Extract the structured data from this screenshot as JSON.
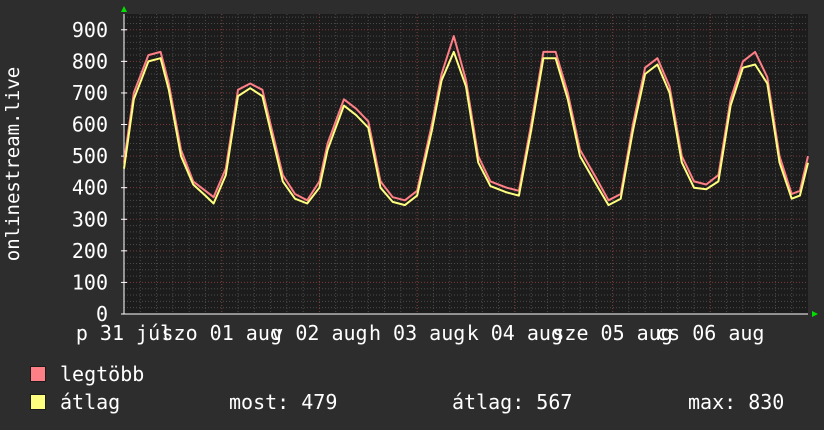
{
  "chart_data": {
    "type": "line",
    "ylabel": "onlinestream.live",
    "ylim": [
      0,
      950
    ],
    "yticks": [
      0,
      100,
      200,
      300,
      400,
      500,
      600,
      700,
      800,
      900
    ],
    "xlim": [
      0,
      8.4
    ],
    "x_ticks": [
      {
        "label": "p 31 júl",
        "x": 0
      },
      {
        "label": "szo 01 aug",
        "x": 1.2
      },
      {
        "label": "v 02 aug",
        "x": 2.4
      },
      {
        "label": "h 03 aug",
        "x": 3.6
      },
      {
        "label": "k 04 aug",
        "x": 4.8
      },
      {
        "label": "sze 05 aug",
        "x": 6.0
      },
      {
        "label": "cs 06 aug",
        "x": 7.2
      }
    ],
    "grid": true,
    "legend_position": "bottom-left",
    "colors": {
      "background": "#2d2d2d",
      "canvas": "#1c1c1c",
      "grid_minor": "#4a4a4a",
      "grid_major": "#7a3a3a",
      "axis": "#ffffff",
      "arrow": "#00e000",
      "text": "#ffffff"
    },
    "series": [
      {
        "name": "legtöbb",
        "color": "#ff7f86",
        "x": [
          0,
          0.12,
          0.3,
          0.45,
          0.55,
          0.7,
          0.85,
          1.0,
          1.1,
          1.25,
          1.4,
          1.55,
          1.7,
          1.8,
          1.95,
          2.1,
          2.25,
          2.4,
          2.5,
          2.7,
          2.85,
          3.0,
          3.15,
          3.3,
          3.45,
          3.6,
          3.78,
          3.9,
          4.05,
          4.2,
          4.35,
          4.5,
          4.7,
          4.85,
          5.0,
          5.15,
          5.3,
          5.45,
          5.6,
          5.8,
          5.95,
          6.1,
          6.25,
          6.4,
          6.55,
          6.7,
          6.85,
          7.0,
          7.15,
          7.3,
          7.45,
          7.6,
          7.75,
          7.9,
          8.05,
          8.2,
          8.3,
          8.4
        ],
        "values": [
          480,
          700,
          820,
          830,
          730,
          520,
          420,
          390,
          370,
          460,
          710,
          730,
          710,
          600,
          440,
          380,
          360,
          420,
          540,
          680,
          650,
          610,
          420,
          370,
          360,
          390,
          600,
          760,
          880,
          740,
          500,
          420,
          400,
          390,
          600,
          830,
          830,
          700,
          520,
          430,
          360,
          380,
          600,
          780,
          810,
          720,
          500,
          420,
          410,
          440,
          680,
          800,
          830,
          750,
          500,
          380,
          390,
          500
        ]
      },
      {
        "name": "átlag",
        "color": "#ffff7f",
        "x": [
          0,
          0.12,
          0.3,
          0.45,
          0.55,
          0.7,
          0.85,
          1.0,
          1.1,
          1.25,
          1.4,
          1.55,
          1.7,
          1.8,
          1.95,
          2.1,
          2.25,
          2.4,
          2.5,
          2.7,
          2.85,
          3.0,
          3.15,
          3.3,
          3.45,
          3.6,
          3.78,
          3.9,
          4.05,
          4.2,
          4.35,
          4.5,
          4.7,
          4.85,
          5.0,
          5.15,
          5.3,
          5.45,
          5.6,
          5.8,
          5.95,
          6.1,
          6.25,
          6.4,
          6.55,
          6.7,
          6.85,
          7.0,
          7.15,
          7.3,
          7.45,
          7.6,
          7.75,
          7.9,
          8.05,
          8.2,
          8.3,
          8.4
        ],
        "values": [
          460,
          680,
          800,
          810,
          710,
          500,
          410,
          375,
          350,
          440,
          690,
          715,
          690,
          580,
          420,
          365,
          350,
          400,
          520,
          660,
          630,
          590,
          400,
          355,
          345,
          375,
          580,
          740,
          830,
          720,
          480,
          405,
          385,
          375,
          580,
          810,
          810,
          680,
          500,
          410,
          345,
          365,
          580,
          760,
          790,
          700,
          480,
          400,
          395,
          420,
          660,
          780,
          790,
          730,
          480,
          365,
          375,
          479
        ]
      }
    ]
  },
  "legend": {
    "items": [
      {
        "label": "legtöbb",
        "color": "#ff7f86"
      },
      {
        "label": "átlag",
        "color": "#ffff7f"
      }
    ],
    "stats": {
      "now": "most: 479",
      "avg": "átlag: 567",
      "max": "max: 830"
    }
  }
}
